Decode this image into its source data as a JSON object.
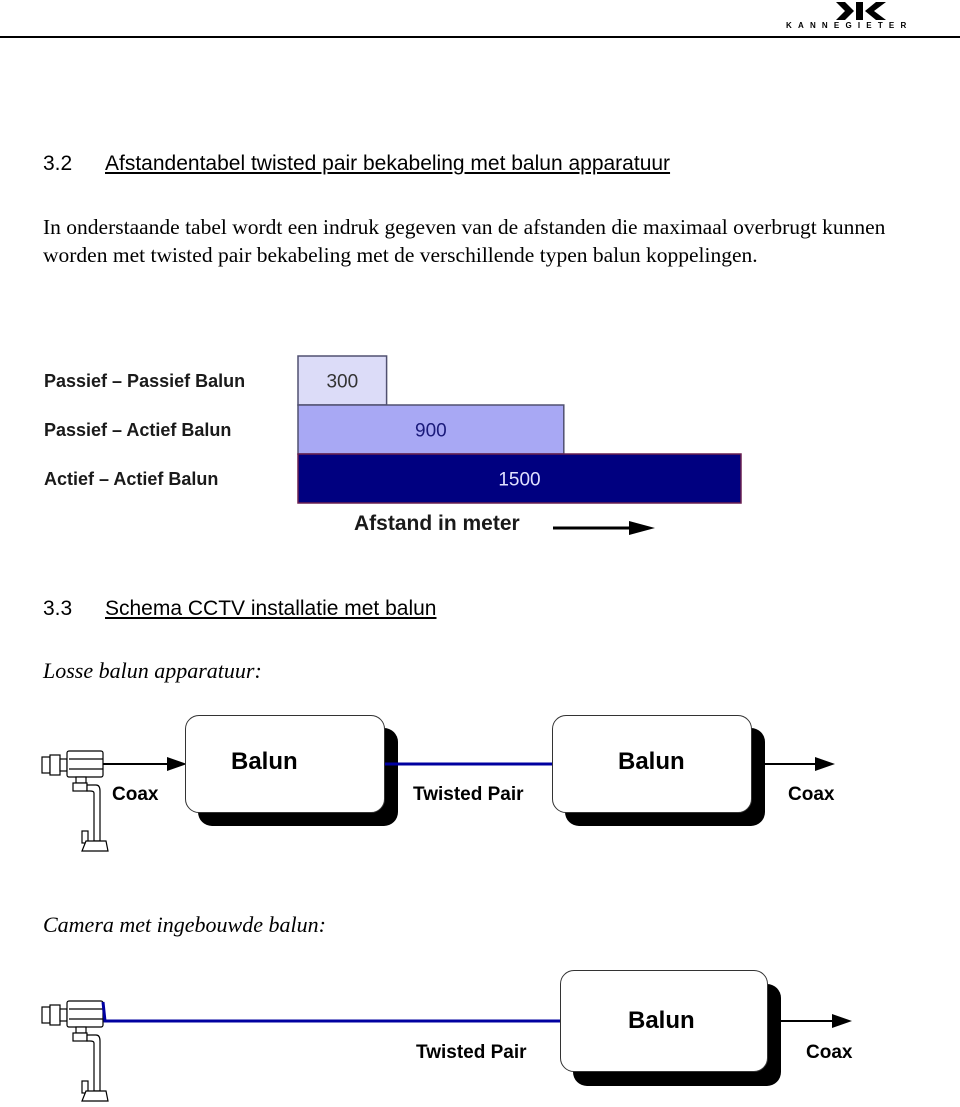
{
  "header": {
    "logo_text": "KANNEGIETER",
    "logo_icon": "kannegieter-k-logo-icon"
  },
  "section_32": {
    "number": "3.2",
    "title": "Afstandentabel  twisted pair bekabeling met balun apparatuur",
    "paragraph": "In onderstaande tabel wordt een indruk gegeven van de afstanden die maximaal overbrugt kunnen worden met twisted pair bekabeling met de verschillende typen balun koppelingen."
  },
  "chart_data": {
    "type": "bar",
    "orientation": "horizontal",
    "title": "",
    "categories": [
      "Passief – Passief Balun",
      "Passief – Actief Balun",
      "Actief – Actief Balun"
    ],
    "values": [
      300,
      900,
      1500
    ],
    "data_labels": [
      "300",
      "900",
      "1500"
    ],
    "xlabel": "Afstand in meter",
    "ylabel": "",
    "xlim": [
      0,
      1500
    ],
    "grid": false,
    "colors": [
      "#dcdcf8",
      "#a8a8f4",
      "#000080"
    ],
    "label_colors": [
      "#333333",
      "#1a1a7a",
      "#e0e0ff"
    ]
  },
  "section_33": {
    "number": "3.3",
    "title": "Schema CCTV installatie met balun",
    "sub1": "Losse balun apparatuur:",
    "sub2": "Camera met ingebouwde balun:"
  },
  "diagram1": {
    "camera_icon": "cctv-camera-icon",
    "coax_left": "Coax",
    "balun_left": "Balun",
    "twisted_pair": "Twisted Pair",
    "balun_right": "Balun",
    "coax_right": "Coax",
    "twisted_pair_color": "#0000a0"
  },
  "diagram2": {
    "camera_icon": "cctv-camera-icon",
    "twisted_pair": "Twisted Pair",
    "balun": "Balun",
    "coax": "Coax",
    "twisted_pair_color": "#0000a0"
  }
}
